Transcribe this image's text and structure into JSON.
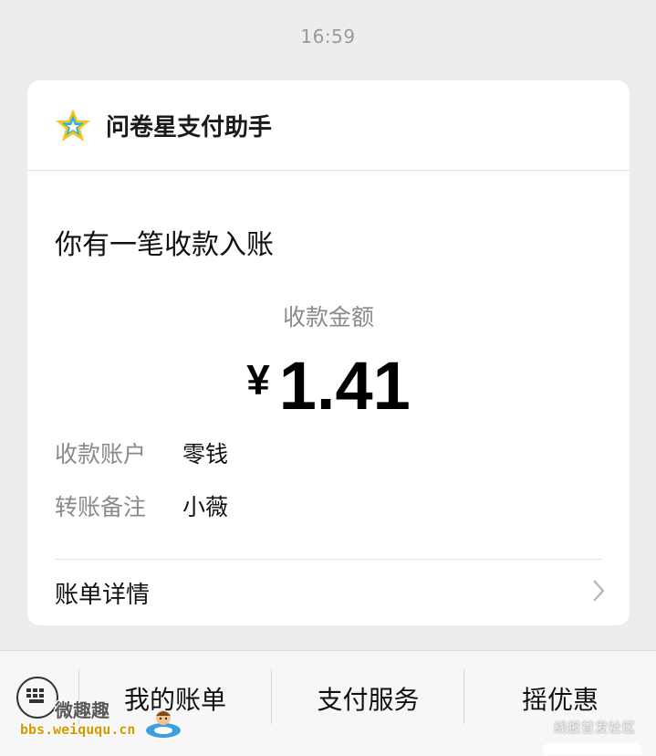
{
  "message": {
    "timestamp": "16:59"
  },
  "card": {
    "app_name": "问卷星支付助手",
    "headline": "你有一笔收款入账",
    "amount_label": "收款金额",
    "currency_symbol": "¥",
    "amount_value": "1.41",
    "details": [
      {
        "key": "收款账户",
        "value": "零钱"
      },
      {
        "key": "转账备注",
        "value": "小薇"
      }
    ],
    "bill_details_label": "账单详情"
  },
  "menu": {
    "items": [
      "我的账单",
      "支付服务",
      "摇优惠"
    ]
  },
  "watermarks": {
    "left_cn": "微趣趣",
    "left_url": "bbs.weiququ.cn",
    "right": "线报首发社区"
  },
  "colors": {
    "background": "#ededed",
    "card": "#ffffff",
    "muted_text": "#8a8a8a",
    "star_gold": "#f5c518",
    "star_blue": "#2bb0e8"
  }
}
